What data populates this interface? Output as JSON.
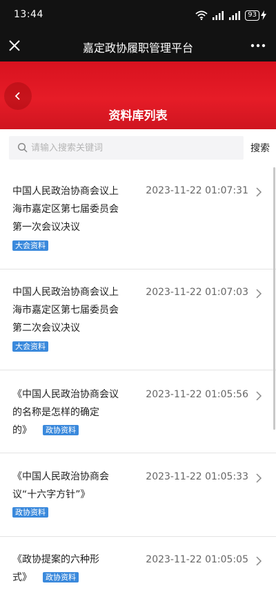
{
  "status_bar": {
    "time": "13:44",
    "battery": "93"
  },
  "app_bar": {
    "title": "嘉定政协履职管理平台"
  },
  "banner": {
    "page_title": "资料库列表"
  },
  "search": {
    "placeholder": "请输入搜索关键词",
    "value": "",
    "button_label": "搜索"
  },
  "items": [
    {
      "title_lines": [
        "中国人民政治协商会议上",
        "海市嘉定区第七届委员会",
        "第一次会议决议"
      ],
      "tag": "大会资料",
      "date": "2023-11-22 01:07:31"
    },
    {
      "title_lines": [
        "中国人民政治协商会议上",
        "海市嘉定区第七届委员会",
        "第二次会议决议"
      ],
      "tag": "大会资料",
      "date": "2023-11-22 01:07:03"
    },
    {
      "title_lines": [
        "《中国人民政治协商会议",
        "的名称是怎样的确定",
        "的》"
      ],
      "tag": "政协资料",
      "date": "2023-11-22 01:05:56"
    },
    {
      "title_lines": [
        "《中国人民政治协商会",
        "议“十六字方针”》"
      ],
      "tag": "政协资料",
      "date": "2023-11-22 01:05:33"
    },
    {
      "title_lines": [
        "《政协提案的六种形",
        "式》"
      ],
      "tag": "政协资料",
      "date": "2023-11-22 01:05:05"
    }
  ],
  "colors": {
    "header_bg": "#121212",
    "banner_red": "#e61c27",
    "tag_blue": "#3a89dc"
  },
  "icons": [
    "wifi-icon",
    "signal-icon",
    "battery-icon",
    "charging-icon",
    "close-icon",
    "more-icon",
    "back-icon",
    "search-icon",
    "chevron-right-icon"
  ]
}
